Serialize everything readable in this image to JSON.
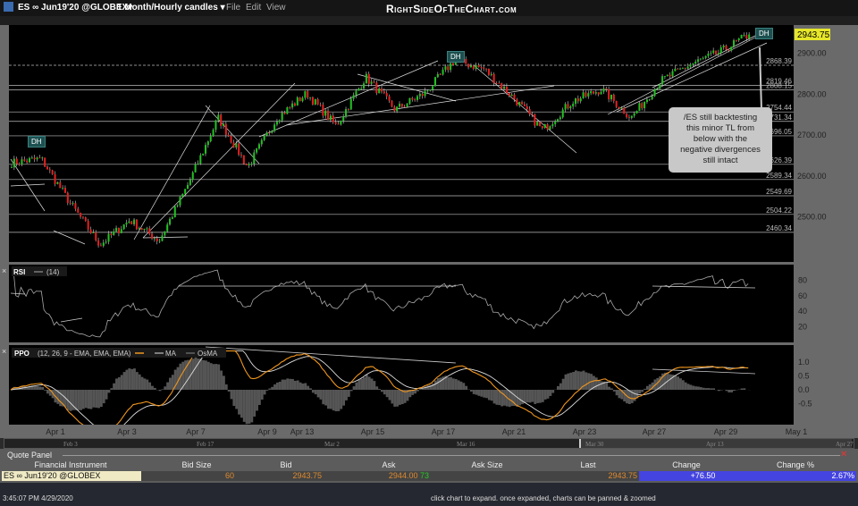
{
  "title_bar": {
    "symbol": "ES ∞ Jun19'20 @GLOBEX▾",
    "timeframe": "1 Month/Hourly candles ▾",
    "menu": [
      "File",
      "Edit",
      "View"
    ],
    "logo": "RightSideOfTheChart.com"
  },
  "price_panel": {
    "last_price_tag": "2943.75",
    "axis_ticks": [
      "2900.00",
      "2800.00",
      "2700.00",
      "2600.00",
      "2500.00"
    ],
    "levels": [
      {
        "value": "2868.39",
        "style": "dashed"
      },
      {
        "value": "2819.46"
      },
      {
        "value": "2808.15"
      },
      {
        "value": "2754.44"
      },
      {
        "value": "2731.34"
      },
      {
        "value": "2696.05"
      },
      {
        "value": "2626.39"
      },
      {
        "value": "2589.34"
      },
      {
        "value": "2549.69"
      },
      {
        "value": "2504.22"
      },
      {
        "value": "2460.34"
      }
    ],
    "dh_labels": [
      "DH",
      "DH",
      "DH"
    ],
    "annotation": [
      "/ES still backtesting",
      "this minor TL from",
      "below with the",
      "negative divergences",
      "still intact"
    ],
    "colors": {
      "up": "#22c022",
      "down": "#e02020",
      "last_tag": "#e6e62a"
    }
  },
  "rsi_panel": {
    "label": "RSI",
    "param": "(14)",
    "axis_ticks": [
      "80",
      "60",
      "40",
      "20"
    ]
  },
  "ppo_panel": {
    "label": "PPO",
    "params": "(12, 26, 9 - EMA, EMA, EMA)",
    "legend": [
      "MA",
      "OsMA"
    ],
    "axis_ticks": [
      "1.0",
      "0.5",
      "0.0",
      "-0.5"
    ],
    "colors": {
      "ppo": "#f0961e",
      "ma": "#dddddd"
    }
  },
  "x_axis": {
    "labels": [
      "Apr 1",
      "Apr 3",
      "Apr 7",
      "Apr 9",
      "Apr 13",
      "Apr 15",
      "Apr 17",
      "Apr 21",
      "Apr 23",
      "Apr 27",
      "Apr 29",
      "May 1"
    ]
  },
  "scroller": {
    "labels": [
      "Feb 3",
      "Feb 17",
      "Mar 2",
      "Mar 16",
      "Mar 30",
      "Apr 13",
      "Apr 27"
    ]
  },
  "chart_data": {
    "type": "candlestick",
    "y_range": [
      2393,
      2970
    ],
    "price_path": [
      2630,
      2640,
      2530,
      2430,
      2490,
      2440,
      2580,
      2740,
      2620,
      2740,
      2800,
      2720,
      2840,
      2760,
      2800,
      2880,
      2860,
      2790,
      2710,
      2780,
      2810,
      2740,
      2830,
      2870,
      2900,
      2943.75
    ]
  },
  "quote_panel": {
    "title": "Quote Panel",
    "headers": [
      "Financial Instrument",
      "Bid Size",
      "Bid",
      "Ask",
      "Ask Size",
      "Last",
      "Change",
      "Change %"
    ],
    "row": {
      "instrument": "ES ∞ Jun19'20 @GLOBEX",
      "bid_size": "60",
      "bid": "2943.75",
      "ask": "2944.00",
      "ask_size_inline": "73",
      "last": "2943.75",
      "change": "+76.50",
      "change_pct": "2.67%"
    }
  },
  "status": {
    "time": "3:45:07 PM 4/29/2020",
    "message": "click chart to expand. once expanded, charts can be panned & zoomed"
  }
}
